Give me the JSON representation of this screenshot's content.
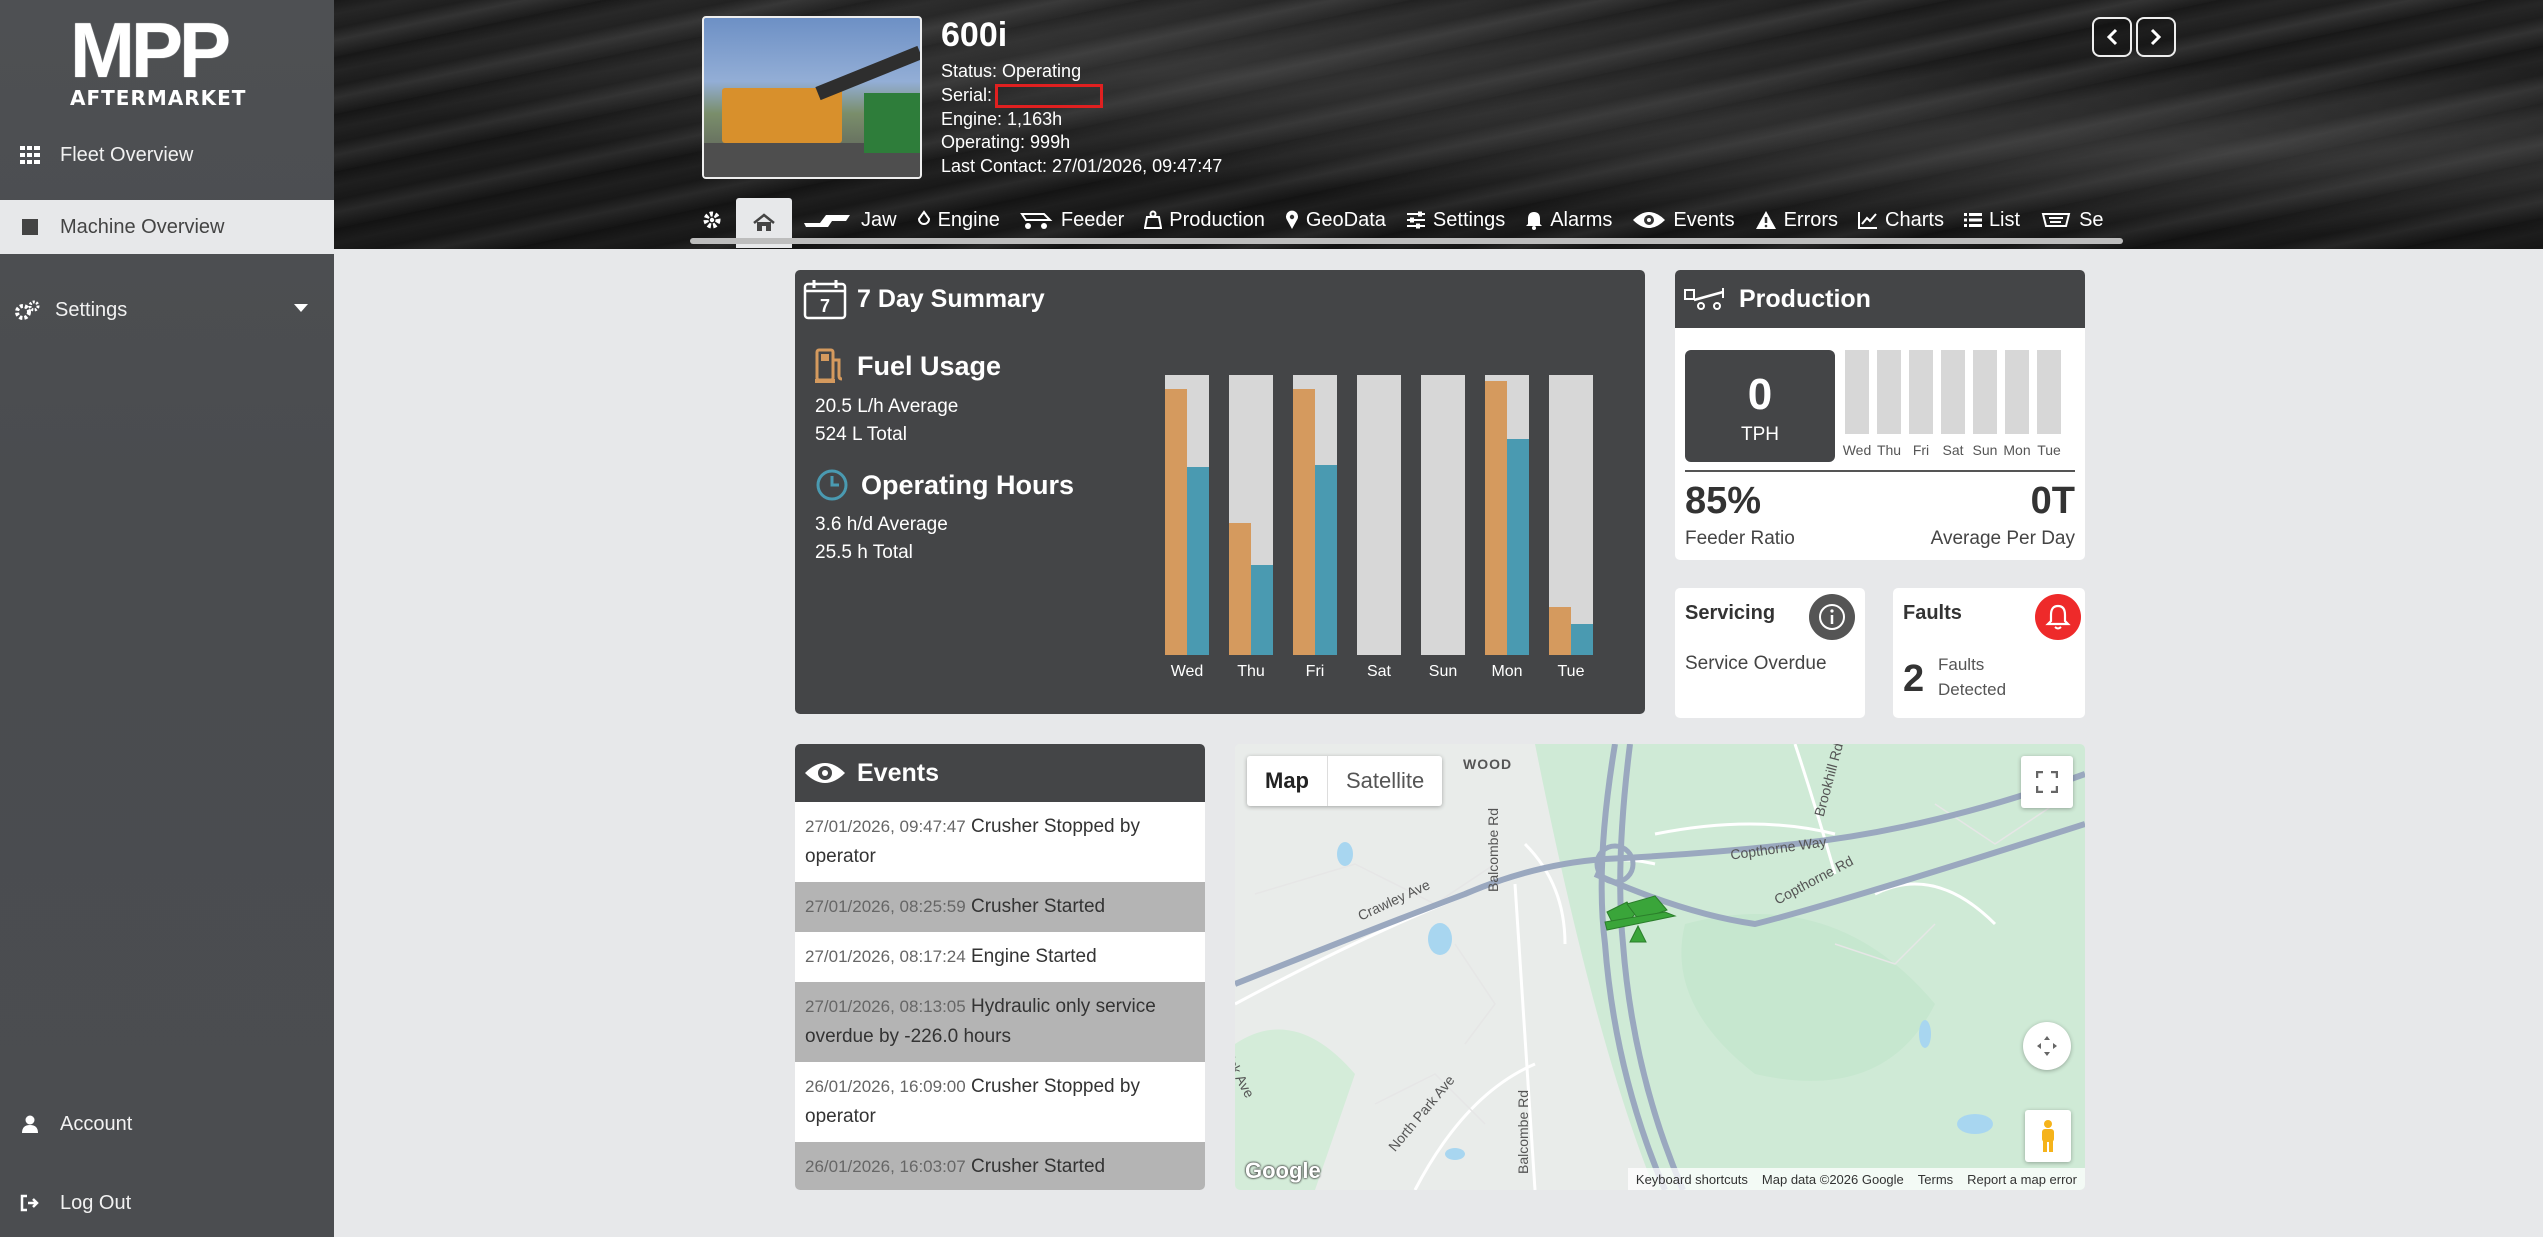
{
  "sidebar": {
    "logo_main": "MPP",
    "logo_sub": "AFTERMARKET",
    "items": [
      {
        "label": "Fleet Overview"
      },
      {
        "label": "Machine Overview"
      },
      {
        "label": "Settings"
      },
      {
        "label": "Account"
      },
      {
        "label": "Log Out"
      }
    ]
  },
  "machine": {
    "name": "600i",
    "status": "Status: Operating",
    "serial_label": "Serial:",
    "engine": "Engine: 1,163h",
    "operating": "Operating: 999h",
    "last_contact": "Last Contact: 27/01/2026, 09:47:47"
  },
  "tabs": [
    {
      "label": "Jaw"
    },
    {
      "label": "Engine"
    },
    {
      "label": "Feeder"
    },
    {
      "label": "Production"
    },
    {
      "label": "GeoData"
    },
    {
      "label": "Settings"
    },
    {
      "label": "Alarms"
    },
    {
      "label": "Events"
    },
    {
      "label": "Errors"
    },
    {
      "label": "Charts"
    },
    {
      "label": "List"
    },
    {
      "label": "Se"
    }
  ],
  "summary": {
    "title": "7 Day Summary",
    "calendar_day": "7",
    "fuel_title": "Fuel Usage",
    "fuel_avg": "20.5 L/h Average",
    "fuel_total": "524 L Total",
    "hours_title": "Operating Hours",
    "hours_avg": "3.6 h/d Average",
    "hours_total": "25.5 h Total"
  },
  "chart_data": {
    "type": "bar",
    "categories": [
      "Wed",
      "Thu",
      "Fri",
      "Sat",
      "Sun",
      "Mon",
      "Tue"
    ],
    "series": [
      {
        "values": [
          0.95,
          0.47,
          0.95,
          0,
          0,
          0.98,
          0.17
        ]
      },
      {
        "values": [
          0.67,
          0.32,
          0.68,
          0,
          0,
          0.77,
          0.11
        ]
      }
    ],
    "ylim": [
      0,
      1
    ],
    "colors": {
      "fuel": "#d59a5e",
      "hours": "#4a9ab1",
      "track": "#d7d7d7"
    }
  },
  "production": {
    "title": "Production",
    "tph_value": "0",
    "tph_unit": "TPH",
    "days": [
      "Wed",
      "Thu",
      "Fri",
      "Sat",
      "Sun",
      "Mon",
      "Tue"
    ],
    "feeder_ratio_value": "85%",
    "feeder_ratio_label": "Feeder Ratio",
    "avg_day_value": "0T",
    "avg_day_label": "Average Per Day"
  },
  "servicing": {
    "title": "Servicing",
    "text": "Service Overdue"
  },
  "faults": {
    "title": "Faults",
    "count": "2",
    "text_line1": "Faults",
    "text_line2": "Detected"
  },
  "events": {
    "title": "Events",
    "items": [
      {
        "ts": "27/01/2026, 09:47:47",
        "text": "Crusher Stopped by operator"
      },
      {
        "ts": "27/01/2026, 08:25:59",
        "text": "Crusher Started"
      },
      {
        "ts": "27/01/2026, 08:17:24",
        "text": "Engine Started"
      },
      {
        "ts": "27/01/2026, 08:13:05",
        "text": "Hydraulic only service overdue by -226.0 hours"
      },
      {
        "ts": "26/01/2026, 16:09:00",
        "text": "Crusher Stopped by operator"
      },
      {
        "ts": "26/01/2026, 16:03:07",
        "text": "Crusher Started"
      }
    ]
  },
  "map": {
    "tab_map": "Map",
    "tab_satellite": "Satellite",
    "labels": [
      "WOOD",
      "Copthorne Way",
      "Copthorne Rd",
      "Crawley Ave",
      "Balcombe Rd",
      "Brookhill Rd",
      "North Park Ave",
      "Balcombe Rd",
      "ick Ave",
      "Co"
    ],
    "footer": [
      "Keyboard shortcuts",
      "Map data ©2026 Google",
      "Terms",
      "Report a map error"
    ],
    "brand": "Google"
  }
}
